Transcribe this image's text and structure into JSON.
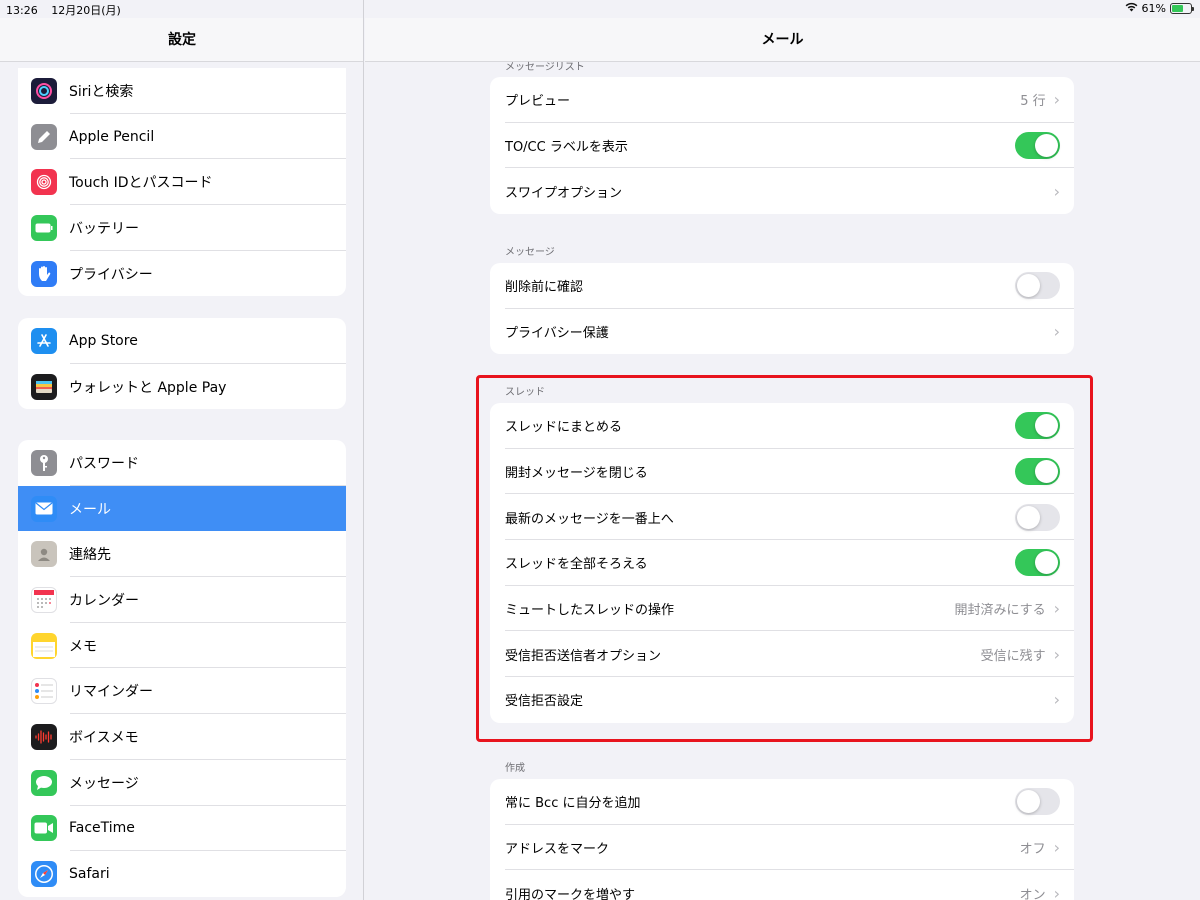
{
  "status": {
    "time": "13:26",
    "date": "12月20日(月)",
    "battery": "61%",
    "battery_level": 0.61
  },
  "sidebar": {
    "title": "設定",
    "groups": [
      {
        "items": [
          {
            "label": "Siriと検索",
            "icon": "siri-icon",
            "color": "#1c1c3a"
          },
          {
            "label": "Apple Pencil",
            "icon": "pencil-icon",
            "color": "#8e8e93"
          },
          {
            "label": "Touch IDとパスコード",
            "icon": "fingerprint-icon",
            "color": "#f2334f"
          },
          {
            "label": "バッテリー",
            "icon": "battery-icon",
            "color": "#34c759"
          },
          {
            "label": "プライバシー",
            "icon": "hand-icon",
            "color": "#2f7cf6"
          }
        ]
      },
      {
        "items": [
          {
            "label": "App Store",
            "icon": "appstore-icon",
            "color": "#1e8ff0"
          },
          {
            "label": "ウォレットと Apple Pay",
            "icon": "wallet-icon",
            "color": "#1c1c1e"
          }
        ]
      },
      {
        "items": [
          {
            "label": "パスワード",
            "icon": "key-icon",
            "color": "#8e8e93"
          },
          {
            "label": "メール",
            "icon": "mail-icon",
            "color": "#2f8cf6",
            "selected": true
          },
          {
            "label": "連絡先",
            "icon": "contacts-icon",
            "color": "#c9c4bc"
          },
          {
            "label": "カレンダー",
            "icon": "calendar-icon",
            "color": "#ffffff"
          },
          {
            "label": "メモ",
            "icon": "notes-icon",
            "color": "#ffd52e"
          },
          {
            "label": "リマインダー",
            "icon": "reminders-icon",
            "color": "#ffffff"
          },
          {
            "label": "ボイスメモ",
            "icon": "voicememo-icon",
            "color": "#1c1c1e"
          },
          {
            "label": "メッセージ",
            "icon": "messages-icon",
            "color": "#34c759"
          },
          {
            "label": "FaceTime",
            "icon": "facetime-icon",
            "color": "#34c759"
          },
          {
            "label": "Safari",
            "icon": "safari-icon",
            "color": "#2f8cf6"
          }
        ]
      }
    ]
  },
  "main": {
    "title": "メール",
    "sections": [
      {
        "label": "メッセージリスト",
        "rows": [
          {
            "label": "プレビュー",
            "type": "link",
            "value": "5 行"
          },
          {
            "label": "TO/CC ラベルを表示",
            "type": "toggle",
            "on": true
          },
          {
            "label": "スワイプオプション",
            "type": "link",
            "value": ""
          }
        ]
      },
      {
        "label": "メッセージ",
        "rows": [
          {
            "label": "削除前に確認",
            "type": "toggle",
            "on": false
          },
          {
            "label": "プライバシー保護",
            "type": "link",
            "value": ""
          }
        ]
      },
      {
        "label": "スレッド",
        "rows": [
          {
            "label": "スレッドにまとめる",
            "type": "toggle",
            "on": true
          },
          {
            "label": "開封メッセージを閉じる",
            "type": "toggle",
            "on": true
          },
          {
            "label": "最新のメッセージを一番上へ",
            "type": "toggle",
            "on": false
          },
          {
            "label": "スレッドを全部そろえる",
            "type": "toggle",
            "on": true
          },
          {
            "label": "ミュートしたスレッドの操作",
            "type": "link",
            "value": "開封済みにする"
          },
          {
            "label": "受信拒否送信者オプション",
            "type": "link",
            "value": "受信に残す"
          },
          {
            "label": "受信拒否設定",
            "type": "link",
            "value": ""
          }
        ]
      },
      {
        "label": "作成",
        "rows": [
          {
            "label": "常に Bcc に自分を追加",
            "type": "toggle",
            "on": false
          },
          {
            "label": "アドレスをマーク",
            "type": "link",
            "value": "オフ"
          },
          {
            "label": "引用のマークを増やす",
            "type": "link",
            "value": "オン"
          }
        ]
      }
    ]
  }
}
